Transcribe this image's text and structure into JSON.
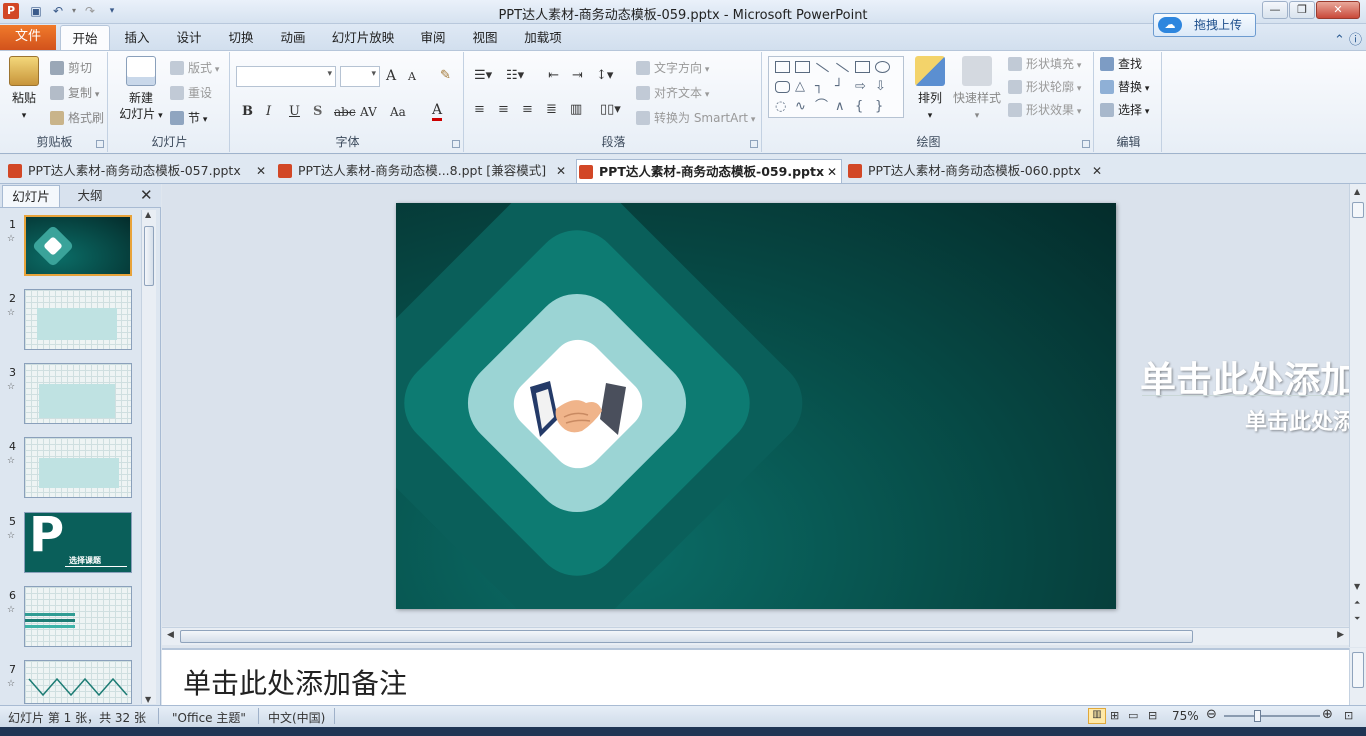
{
  "window": {
    "title": "PPT达人素材-商务动态模板-059.pptx - Microsoft PowerPoint",
    "app_icon": "P",
    "controls": [
      "—",
      "❐",
      "✕"
    ]
  },
  "quick_access": {
    "save": "save-icon",
    "undo": "undo-icon",
    "redo": "redo-icon",
    "customize": "customize-icon"
  },
  "upload_button": {
    "label": "拖拽上传",
    "icon": "cloud-icon"
  },
  "ribbon_tabs": [
    "文件",
    "开始",
    "插入",
    "设计",
    "切换",
    "动画",
    "幻灯片放映",
    "审阅",
    "视图",
    "加载项"
  ],
  "active_tab": "开始",
  "ribbon": {
    "clipboard": {
      "label": "剪贴板",
      "paste": "粘贴",
      "cut": "剪切",
      "copy": "复制",
      "format_painter": "格式刷"
    },
    "slides": {
      "label": "幻灯片",
      "new_slide_line1": "新建",
      "new_slide_line2": "幻灯片",
      "layout": "版式",
      "reset": "重设",
      "section": "节"
    },
    "font": {
      "label": "字体",
      "bold": "B",
      "italic": "I",
      "underline": "U",
      "shadow": "S",
      "strike": "abc",
      "spacing": "AV",
      "case": "Aa",
      "color": "A",
      "grow": "A",
      "shrink": "A"
    },
    "paragraph": {
      "label": "段落",
      "text_direction": "文字方向",
      "align_text": "对齐文本",
      "smartart": "转换为 SmartArt"
    },
    "drawing": {
      "label": "绘图",
      "arrange": "排列",
      "quick_styles": "快速样式",
      "shape_fill": "形状填充",
      "shape_outline": "形状轮廓",
      "shape_effects": "形状效果"
    },
    "editing": {
      "label": "编辑",
      "find": "查找",
      "replace": "替换",
      "select": "选择"
    }
  },
  "doc_tabs": [
    {
      "label": "PPT达人素材-商务动态模板-057.pptx",
      "active": false
    },
    {
      "label": "PPT达人素材-商务动态模...8.ppt [兼容模式]",
      "active": false
    },
    {
      "label": "PPT达人素材-商务动态模板-059.pptx",
      "active": true
    },
    {
      "label": "PPT达人素材-商务动态模板-060.pptx",
      "active": false
    }
  ],
  "left_pane": {
    "tabs": [
      "幻灯片",
      "大纲"
    ],
    "thumbnails": [
      {
        "num": "1",
        "text": ""
      },
      {
        "num": "2",
        "text": ""
      },
      {
        "num": "3",
        "text": ""
      },
      {
        "num": "4",
        "text": ""
      },
      {
        "num": "5",
        "text": "选择课题"
      },
      {
        "num": "6",
        "text": ""
      },
      {
        "num": "7",
        "text": ""
      }
    ],
    "thumb5_letter": "P"
  },
  "slide": {
    "title_placeholder": "单击此处添加",
    "subtitle_placeholder": "单击此处添",
    "colors": {
      "bg_dark": "#042c2b",
      "bg_mid": "#07504b",
      "diamond1": "#0a5f5a",
      "diamond2": "#0d7b72",
      "diamond3": "#9bd4d4",
      "diamond4": "#ffffff"
    }
  },
  "notes": {
    "placeholder": "单击此处添加备注"
  },
  "status": {
    "slide_info": "幻灯片 第 1 张，共 32 张",
    "theme": "\"Office 主题\"",
    "language": "中文(中国)",
    "zoom": "75%"
  }
}
